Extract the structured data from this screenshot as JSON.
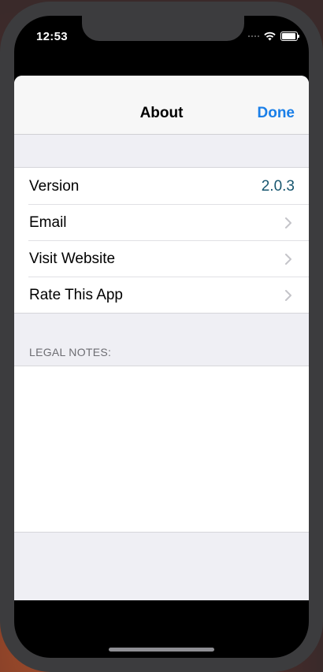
{
  "status_bar": {
    "time": "12:53",
    "icons": [
      "signal-dots-icon",
      "wifi-icon",
      "battery-icon"
    ]
  },
  "navbar": {
    "title": "About",
    "done_label": "Done"
  },
  "settings": {
    "rows": [
      {
        "label": "Version",
        "value": "2.0.3",
        "accessory": "value"
      },
      {
        "label": "Email",
        "accessory": "chevron-right-icon"
      },
      {
        "label": "Visit Website",
        "accessory": "chevron-right-icon"
      },
      {
        "label": "Rate This App",
        "accessory": "chevron-right-icon"
      }
    ]
  },
  "legal": {
    "header": "LEGAL NOTES:",
    "body": ""
  },
  "colors": {
    "accent": "#1a7fe8",
    "version_value": "#17566f",
    "grouped_background": "#efeff4",
    "section_header": "#6d6d72"
  }
}
